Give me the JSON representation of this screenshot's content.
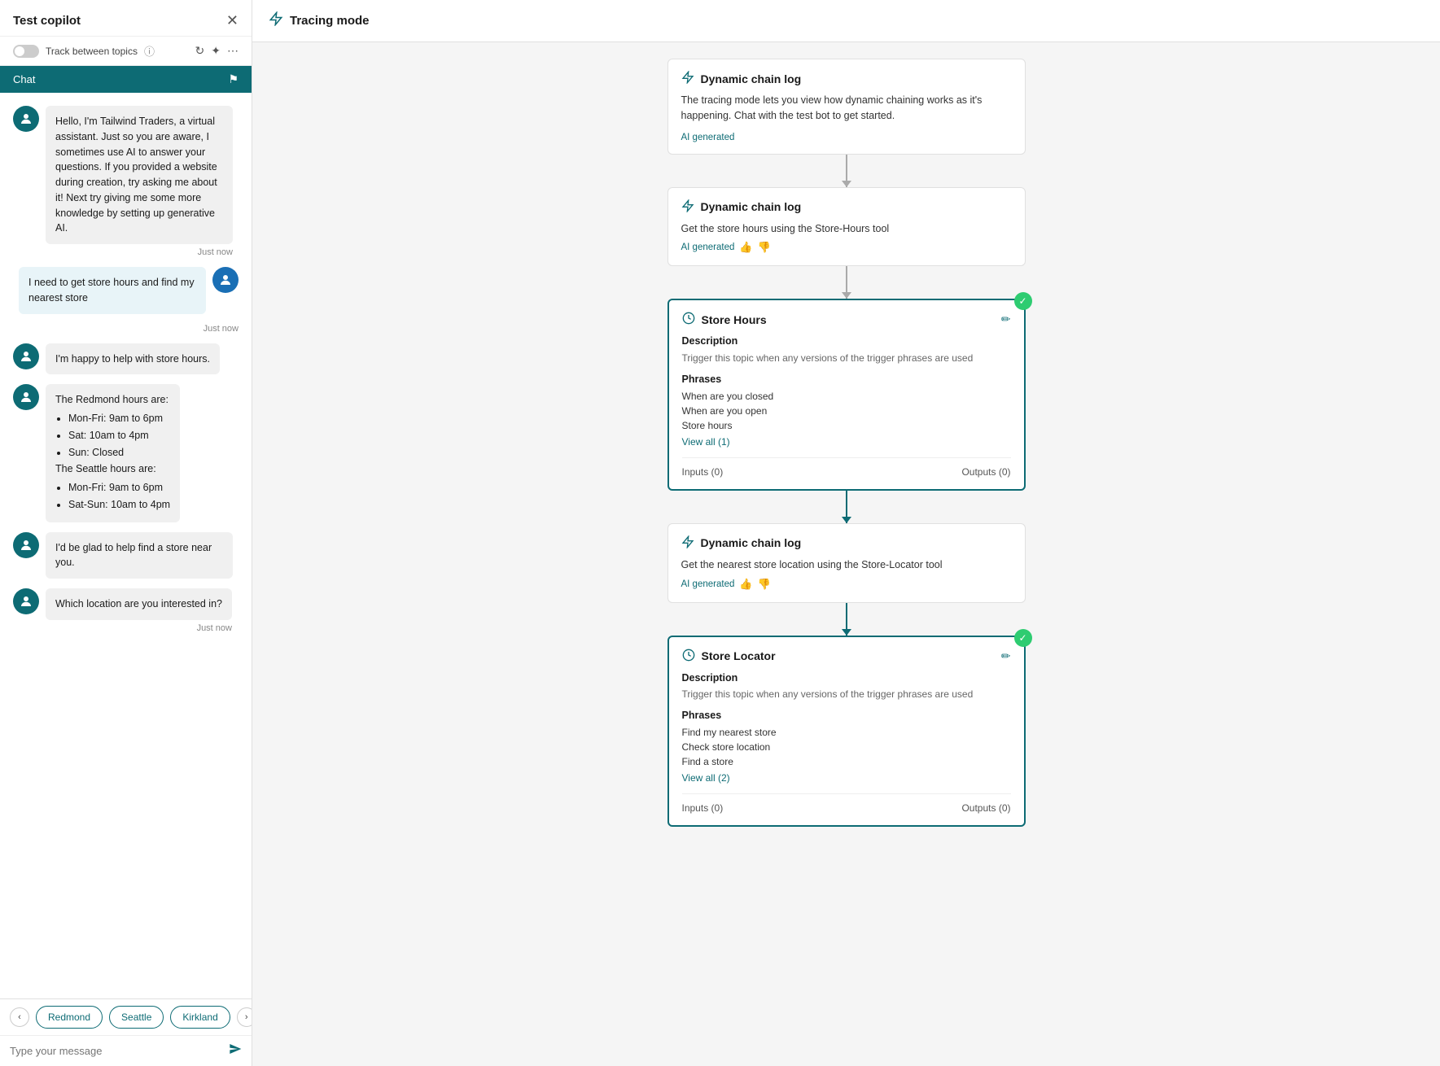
{
  "leftPanel": {
    "title": "Test copilot",
    "trackLabel": "Track between topics",
    "chatTabLabel": "Chat",
    "messages": [
      {
        "type": "bot",
        "text": "Hello, I'm Tailwind Traders, a virtual assistant. Just so you are aware, I sometimes use AI to answer your questions. If you provided a website during creation, try asking me about it! Next try giving me some more knowledge by setting up generative AI.",
        "time": "Just now"
      },
      {
        "type": "user",
        "text": "I need to get store hours and find my nearest store"
      },
      {
        "type": "user-time",
        "time": "Just now"
      },
      {
        "type": "bot-simple",
        "text": "I'm happy to help with store hours."
      },
      {
        "type": "bot-complex",
        "lines": [
          "The Redmond hours are:",
          "Mon-Fri: 9am to 6pm",
          "Sat: 10am to 4pm",
          "Sun: Closed",
          "The Seattle hours are:",
          "Mon-Fri: 9am to 6pm",
          "Sat-Sun: 10am to 4pm"
        ]
      },
      {
        "type": "bot-simple",
        "text": "I'd be glad to help find a store near you."
      },
      {
        "type": "bot-simple",
        "text": "Which location are you interested in?"
      },
      {
        "type": "bot-time",
        "time": "Just now"
      }
    ],
    "quickReplies": [
      "Redmond",
      "Seattle",
      "Kirkland"
    ],
    "inputPlaceholder": "Type your message"
  },
  "tracingPanel": {
    "title": "Tracing mode",
    "nodes": [
      {
        "id": "node1",
        "type": "dynamic-chain",
        "title": "Dynamic chain log",
        "body": "The tracing mode lets you view how dynamic chaining works as it's happening. Chat with the test bot to get started.",
        "aiGenerated": true,
        "aiGeneratedLabel": "AI generated",
        "showThumbs": false,
        "highlighted": false,
        "hasCheck": false,
        "hasEditBtn": false,
        "hasInputOutput": false
      },
      {
        "id": "node2",
        "type": "dynamic-chain",
        "title": "Dynamic chain log",
        "body": "Get the store hours using the Store-Hours tool",
        "aiGenerated": true,
        "aiGeneratedLabel": "AI generated",
        "showThumbs": true,
        "highlighted": false,
        "hasCheck": false,
        "hasEditBtn": false,
        "hasInputOutput": false
      },
      {
        "id": "node3",
        "type": "store-hours",
        "title": "Store Hours",
        "highlighted": true,
        "hasCheck": true,
        "hasEditBtn": true,
        "description": "Trigger this topic when any versions of the trigger phrases are used",
        "phrasesLabel": "Phrases",
        "phrases": [
          "When are you closed",
          "When are you open",
          "Store hours"
        ],
        "viewAllLabel": "View all (1)",
        "inputsLabel": "Inputs (0)",
        "outputsLabel": "Outputs (0)"
      },
      {
        "id": "node4",
        "type": "dynamic-chain",
        "title": "Dynamic chain log",
        "body": "Get the nearest store location using the Store-Locator tool",
        "aiGenerated": true,
        "aiGeneratedLabel": "AI generated",
        "showThumbs": true,
        "highlighted": false,
        "hasCheck": false,
        "hasEditBtn": false,
        "hasInputOutput": false
      },
      {
        "id": "node5",
        "type": "store-locator",
        "title": "Store Locator",
        "highlighted": true,
        "hasCheck": true,
        "hasEditBtn": true,
        "description": "Trigger this topic when any versions of the trigger phrases are used",
        "phrasesLabel": "Phrases",
        "phrases": [
          "Find my nearest store",
          "Check store location",
          "Find a store"
        ],
        "viewAllLabel": "View all (2)",
        "inputsLabel": "Inputs (0)",
        "outputsLabel": "Outputs (0)"
      }
    ]
  }
}
